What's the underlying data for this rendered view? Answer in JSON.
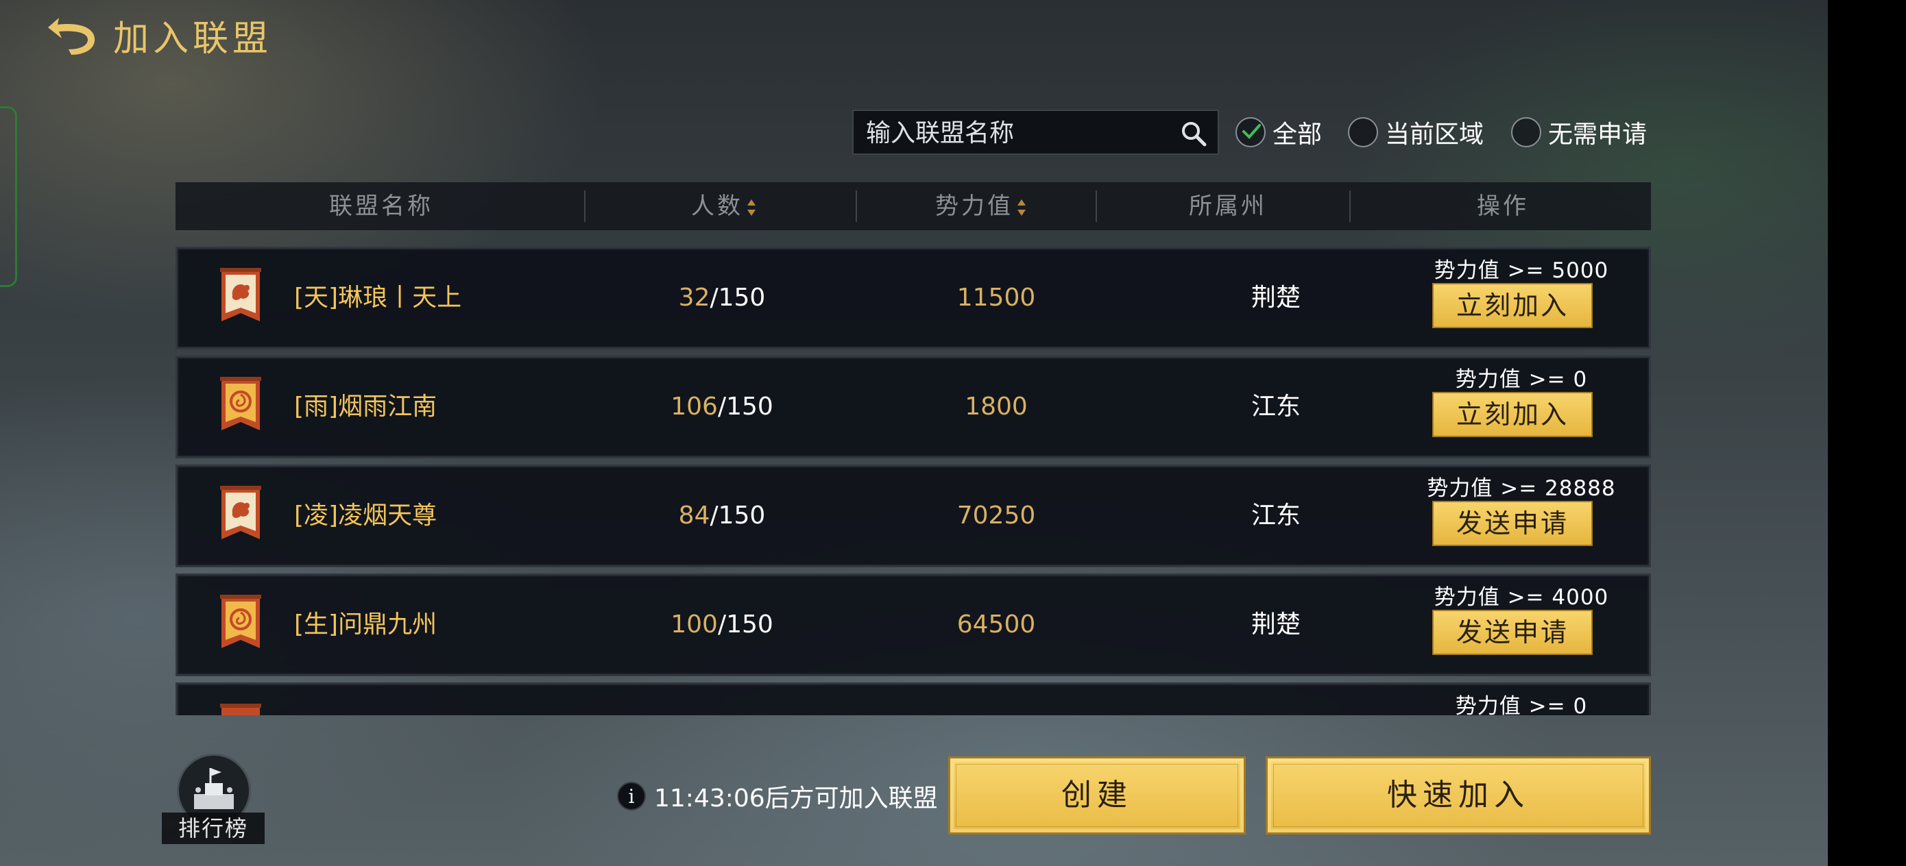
{
  "header": {
    "title": "加入联盟"
  },
  "search": {
    "placeholder": "输入联盟名称"
  },
  "filters": [
    {
      "label": "全部",
      "checked": true
    },
    {
      "label": "当前区域",
      "checked": false
    },
    {
      "label": "无需申请",
      "checked": false
    }
  ],
  "table": {
    "columns": [
      "联盟名称",
      "人数",
      "势力值",
      "所属州",
      "操作"
    ],
    "rows": [
      {
        "name": "[天]琳琅丨天上",
        "members_current": "32",
        "members_max": "/150",
        "power": "11500",
        "region": "荆楚",
        "requirement": "势力值 >= 5000",
        "action": "立刻加入",
        "emblem": "dragon"
      },
      {
        "name": "[雨]烟雨江南",
        "members_current": "106",
        "members_max": "/150",
        "power": "1800",
        "region": "江东",
        "requirement": "势力值 >= 0",
        "action": "立刻加入",
        "emblem": "swirl"
      },
      {
        "name": "[凌]凌烟天尊",
        "members_current": "84",
        "members_max": "/150",
        "power": "70250",
        "region": "江东",
        "requirement": "势力值 >= 28888",
        "action": "发送申请",
        "emblem": "dragon"
      },
      {
        "name": "[生]问鼎九州",
        "members_current": "100",
        "members_max": "/150",
        "power": "64500",
        "region": "荆楚",
        "requirement": "势力值 >= 4000",
        "action": "发送申请",
        "emblem": "swirl"
      },
      {
        "name": "",
        "members_current": "",
        "members_max": "",
        "power": "",
        "region": "",
        "requirement": "势力值 >= 0",
        "action": "",
        "emblem": "red"
      }
    ]
  },
  "footer": {
    "rank_label": "排行榜",
    "timer_text": "11:43:06后方可加入联盟",
    "info_icon": "i",
    "create_label": "创建",
    "quick_join_label": "快速加入"
  },
  "colors": {
    "gold": "#f2c55a",
    "button": "#f7d46b",
    "check": "#3fbf5a"
  }
}
